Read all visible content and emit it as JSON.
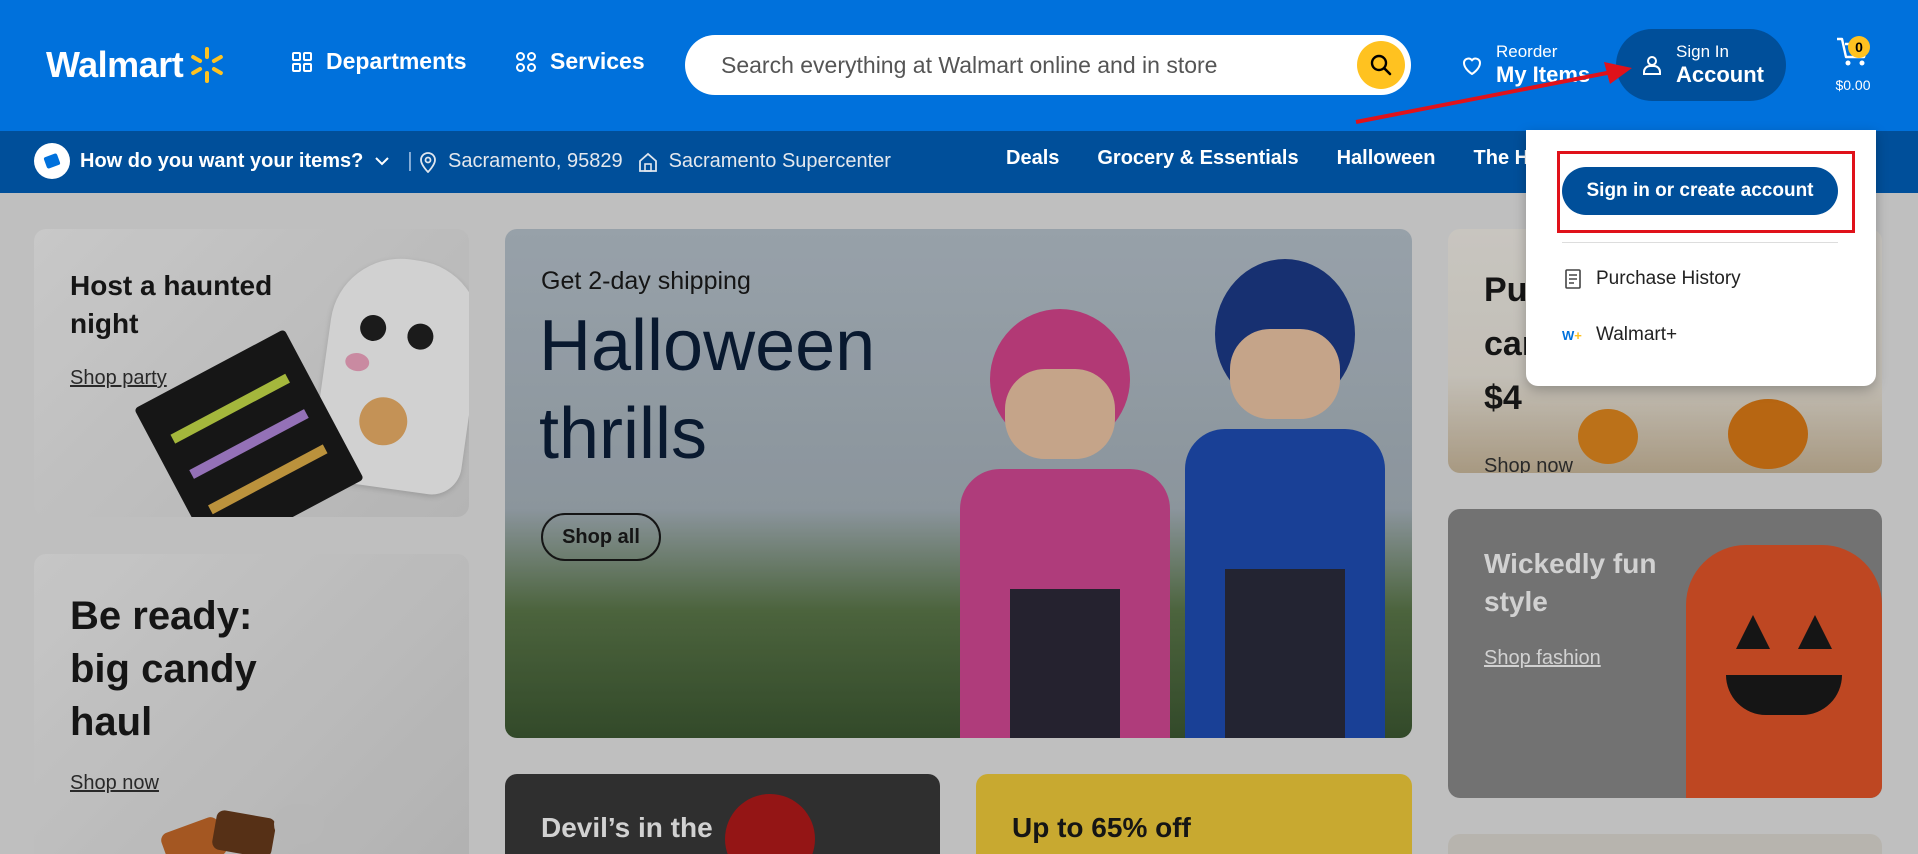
{
  "header": {
    "logo_text": "Walmart",
    "departments": "Departments",
    "services": "Services",
    "search_placeholder": "Search everything at Walmart online and in store",
    "reorder_small": "Reorder",
    "reorder_big": "My Items",
    "account_small": "Sign In",
    "account_big": "Account",
    "cart_count": "0",
    "cart_total": "$0.00",
    "brand_color": "#0071dc",
    "accent_color": "#ffc220"
  },
  "subbar": {
    "fulfillment": "How do you want your items?",
    "location": "Sacramento, 95829",
    "store": "Sacramento Supercenter",
    "categories": [
      "Deals",
      "Grocery & Essentials",
      "Halloween",
      "The Holi"
    ]
  },
  "cards": {
    "haunted": {
      "title": "Host a haunted night",
      "link": "Shop party"
    },
    "candy": {
      "title": "Be ready: big candy haul",
      "link": "Shop now"
    },
    "hero": {
      "kicker": "Get 2-day shipping",
      "headline_1": "Halloween",
      "headline_2": "thrills",
      "button": "Shop all"
    },
    "devil": {
      "title": "Devil’s in the"
    },
    "sale": {
      "title": "Up to 65% off"
    },
    "pumpkin": {
      "title_1": "Pu",
      "title_2": "car",
      "title_3": "$4",
      "link": "Shop now"
    },
    "fashion": {
      "title": "Wickedly fun style",
      "link": "Shop fashion"
    }
  },
  "dropdown": {
    "signin_button": "Sign in or create account",
    "purchase_history": "Purchase History",
    "walmart_plus": "Walmart+",
    "highlight_color": "#e0121a"
  }
}
